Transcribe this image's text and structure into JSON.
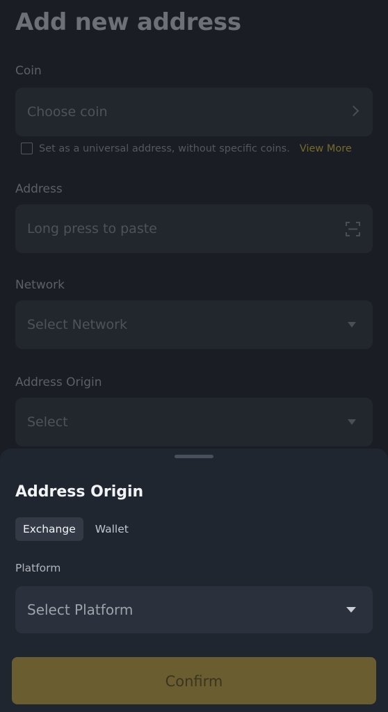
{
  "page": {
    "title": "Add new address"
  },
  "coin": {
    "label": "Coin",
    "placeholder": "Choose coin"
  },
  "universal": {
    "text": "Set as a universal address, without specific coins.",
    "link": "View More"
  },
  "address": {
    "label": "Address",
    "placeholder": "Long press to paste"
  },
  "network": {
    "label": "Network",
    "placeholder": "Select Network"
  },
  "origin": {
    "label": "Address Origin",
    "placeholder": "Select"
  },
  "sheet": {
    "title": "Address Origin",
    "tabs": [
      {
        "label": "Exchange",
        "active": true
      },
      {
        "label": "Wallet",
        "active": false
      }
    ],
    "platform_label": "Platform",
    "platform_placeholder": "Select Platform",
    "confirm_label": "Confirm"
  },
  "colors": {
    "accent": "#776b2a",
    "confirm_bg": "#6a5d30",
    "sheet_bg": "#202630"
  }
}
